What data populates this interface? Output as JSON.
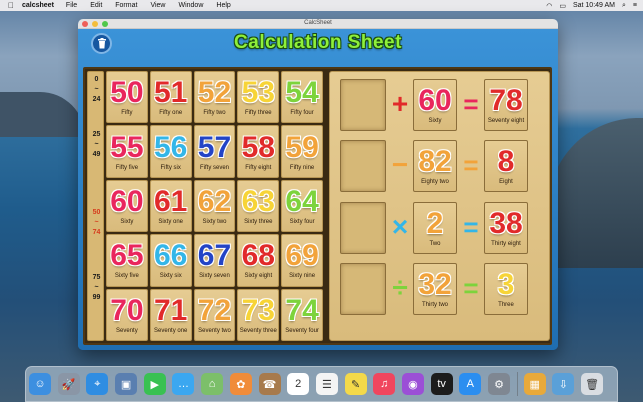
{
  "menubar": {
    "apple": "",
    "app_name": "calcsheet",
    "menus": [
      "File",
      "Edit",
      "Format",
      "View",
      "Window",
      "Help"
    ],
    "clock": "Sat 10:49 AM"
  },
  "window": {
    "title": "CalcSheet",
    "app_title": "Calculation Sheet"
  },
  "ranges": [
    {
      "from": "0",
      "to": "24",
      "color": "#1a1a1a"
    },
    {
      "from": "25",
      "to": "49",
      "color": "#1a1a1a"
    },
    {
      "from": "50",
      "to": "74",
      "color": "#d63a1c"
    },
    {
      "from": "75",
      "to": "99",
      "color": "#1a1a1a"
    }
  ],
  "grid": [
    [
      {
        "n": "50",
        "w": "Fifty",
        "c": "#e9265d"
      },
      {
        "n": "51",
        "w": "Fifty one",
        "c": "#e12a2a"
      },
      {
        "n": "52",
        "w": "Fifty two",
        "c": "#f2a33a"
      },
      {
        "n": "53",
        "w": "Fifty three",
        "c": "#f7d437"
      },
      {
        "n": "54",
        "w": "Fifty four",
        "c": "#7dd33c"
      }
    ],
    [
      {
        "n": "55",
        "w": "Fifty five",
        "c": "#e9265d"
      },
      {
        "n": "56",
        "w": "Fifty six",
        "c": "#33b6e8"
      },
      {
        "n": "57",
        "w": "Fifty seven",
        "c": "#2344c6"
      },
      {
        "n": "58",
        "w": "Fifty eight",
        "c": "#e12a2a"
      },
      {
        "n": "59",
        "w": "Fifty nine",
        "c": "#f2a33a"
      }
    ],
    [
      {
        "n": "60",
        "w": "Sixty",
        "c": "#e9265d"
      },
      {
        "n": "61",
        "w": "Sixty one",
        "c": "#e12a2a"
      },
      {
        "n": "62",
        "w": "Sixty two",
        "c": "#f2a33a"
      },
      {
        "n": "63",
        "w": "Sixty three",
        "c": "#f7d437"
      },
      {
        "n": "64",
        "w": "Sixty four",
        "c": "#7dd33c"
      }
    ],
    [
      {
        "n": "65",
        "w": "Sixty five",
        "c": "#e9265d"
      },
      {
        "n": "66",
        "w": "Sixty six",
        "c": "#33b6e8"
      },
      {
        "n": "67",
        "w": "Sixty seven",
        "c": "#2344c6"
      },
      {
        "n": "68",
        "w": "Sixty eight",
        "c": "#e12a2a"
      },
      {
        "n": "69",
        "w": "Sixty nine",
        "c": "#f2a33a"
      }
    ],
    [
      {
        "n": "70",
        "w": "Seventy",
        "c": "#e9265d"
      },
      {
        "n": "71",
        "w": "Seventy one",
        "c": "#e12a2a"
      },
      {
        "n": "72",
        "w": "Seventy two",
        "c": "#f2a33a"
      },
      {
        "n": "73",
        "w": "Seventy three",
        "c": "#f7d437"
      },
      {
        "n": "74",
        "w": "Seventy four",
        "c": "#7dd33c"
      }
    ]
  ],
  "equations": [
    {
      "op": "+",
      "op_color": "#e12a2a",
      "operand": "60",
      "operand_word": "Sixty",
      "operand_color": "#e9265d",
      "eq_color": "#e9265d",
      "result": "78",
      "result_word": "Seventy eight",
      "result_color": "#e12a2a"
    },
    {
      "op": "−",
      "op_color": "#f2a33a",
      "operand": "82",
      "operand_word": "Eighty two",
      "operand_color": "#f2a33a",
      "eq_color": "#f2a33a",
      "result": "8",
      "result_word": "Eight",
      "result_color": "#e12a2a"
    },
    {
      "op": "×",
      "op_color": "#33b6e8",
      "operand": "2",
      "operand_word": "Two",
      "operand_color": "#f2a33a",
      "eq_color": "#33b6e8",
      "result": "38",
      "result_word": "Thirty eight",
      "result_color": "#e12a2a"
    },
    {
      "op": "÷",
      "op_color": "#7dd33c",
      "operand": "32",
      "operand_word": "Thirty two",
      "operand_color": "#f2a33a",
      "eq_color": "#7dd33c",
      "result": "3",
      "result_word": "Three",
      "result_color": "#f7d437"
    }
  ],
  "dock": [
    {
      "name": "finder",
      "color": "#3d8fe0",
      "glyph": "☺"
    },
    {
      "name": "launchpad",
      "color": "#8a96a6",
      "glyph": "🚀"
    },
    {
      "name": "safari",
      "color": "#2f8de2",
      "glyph": "⌖"
    },
    {
      "name": "photo-booth",
      "color": "#5a7fb0",
      "glyph": "▣"
    },
    {
      "name": "facetime",
      "color": "#39c152",
      "glyph": "▶"
    },
    {
      "name": "messages",
      "color": "#3ba7f0",
      "glyph": "…"
    },
    {
      "name": "maps",
      "color": "#7cbf6a",
      "glyph": "⌂"
    },
    {
      "name": "photos",
      "color": "#f08c3a",
      "glyph": "✿"
    },
    {
      "name": "contacts",
      "color": "#a77a4c",
      "glyph": "☎"
    },
    {
      "name": "calendar",
      "color": "#ffffff",
      "glyph": "2"
    },
    {
      "name": "reminders",
      "color": "#f4f4f4",
      "glyph": "☰"
    },
    {
      "name": "notes",
      "color": "#f4d94a",
      "glyph": "✎"
    },
    {
      "name": "music",
      "color": "#f0465e",
      "glyph": "♫"
    },
    {
      "name": "podcasts",
      "color": "#9b4fd6",
      "glyph": "◉"
    },
    {
      "name": "apple-tv",
      "color": "#1c1c1c",
      "glyph": "tv"
    },
    {
      "name": "app-store",
      "color": "#2b8ef0",
      "glyph": "A"
    },
    {
      "name": "system-preferences",
      "color": "#7f8792",
      "glyph": "⚙"
    },
    {
      "name": "calcsheet",
      "color": "#e8a93a",
      "glyph": "▦"
    },
    {
      "name": "downloads",
      "color": "#5aa0d8",
      "glyph": "⇩"
    },
    {
      "name": "trash",
      "color": "#d9dde2",
      "glyph": "🗑"
    }
  ]
}
